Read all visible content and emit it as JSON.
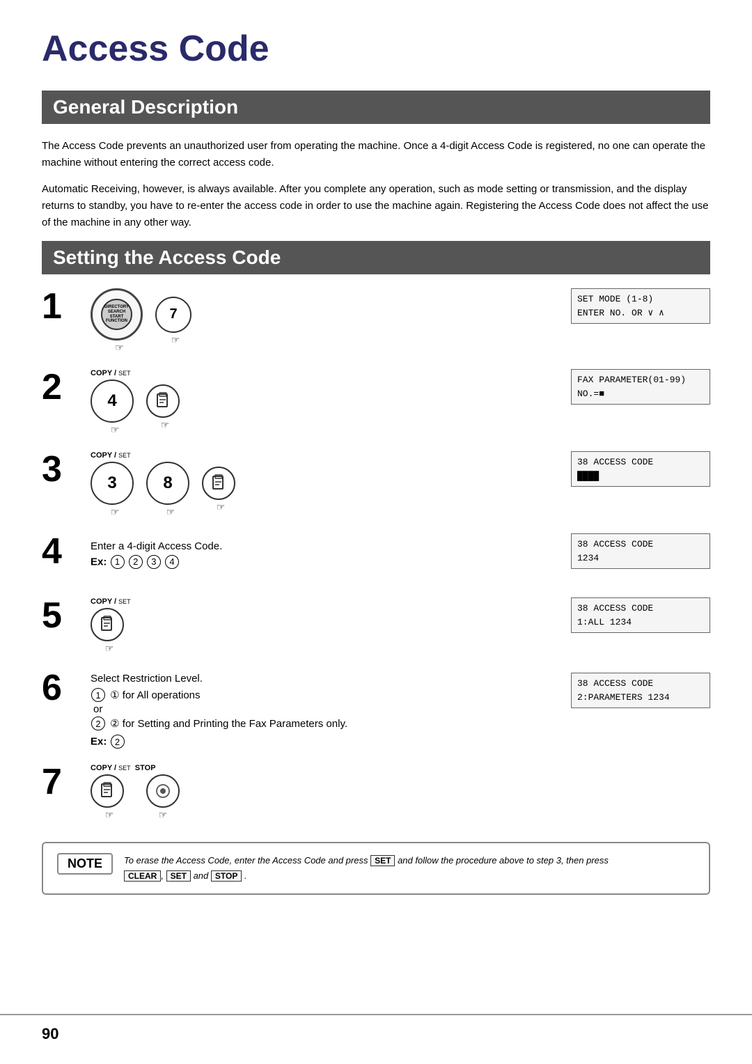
{
  "page": {
    "title": "Access Code",
    "page_number": "90",
    "sections": {
      "general": {
        "header": "General Description",
        "paragraph1": "The Access Code prevents an unauthorized user from operating the machine.  Once a 4-digit Access Code is registered, no one can operate the machine without entering the correct access code.",
        "paragraph2": "Automatic Receiving, however, is always available.  After you complete any operation, such as mode setting or transmission, and the display returns to standby, you have to re-enter the access code in order to use the machine again.  Registering the Access Code does not affect the use of the machine in any other way."
      },
      "setting": {
        "header": "Setting the Access Code",
        "steps": [
          {
            "number": "1",
            "lcd": {
              "line1": "SET MODE       (1-8)",
              "line2": "ENTER NO. OR ∨ ∧"
            },
            "buttons": [
              "7"
            ],
            "type": "dial"
          },
          {
            "number": "2",
            "lcd": {
              "line1": "FAX PARAMETER(01-99)",
              "line2": "NO.=■"
            },
            "buttons": [
              "4"
            ],
            "type": "number_copy",
            "copy_set": true
          },
          {
            "number": "3",
            "lcd": {
              "line1": "38 ACCESS CODE",
              "line2": "████"
            },
            "buttons": [
              "3",
              "8"
            ],
            "type": "number_copy",
            "copy_set": true
          },
          {
            "number": "4",
            "lcd": {
              "line1": "38 ACCESS CODE",
              "line2": "            1234"
            },
            "type": "text",
            "text": "Enter a 4-digit Access Code.",
            "ex": "Ex: ①②③④"
          },
          {
            "number": "5",
            "lcd": {
              "line1": "38 ACCESS CODE",
              "line2": "1:ALL        1234"
            },
            "type": "copy_only",
            "copy_set": true
          },
          {
            "number": "6",
            "lcd": {
              "line1": "38 ACCESS CODE",
              "line2": "2:PARAMETERS  1234"
            },
            "type": "text_restrict",
            "text1": "Select Restriction Level.",
            "option1": "① for All operations",
            "or_text": "or",
            "option2": "② for Setting and Printing the Fax Parameters only.",
            "ex": "Ex: ②"
          },
          {
            "number": "7",
            "type": "copy_stop",
            "copy_set": true,
            "stop": true
          }
        ]
      }
    },
    "note": {
      "label": "NOTE",
      "text1": "To erase the Access Code, enter the Access Code and press",
      "key1": "SET",
      "text2": "and follow the procedure above to step 3, then press",
      "key2": "CLEAR",
      "text3": ",",
      "key3": "SET",
      "text4": "and",
      "key4": "STOP",
      "text5": "."
    }
  }
}
